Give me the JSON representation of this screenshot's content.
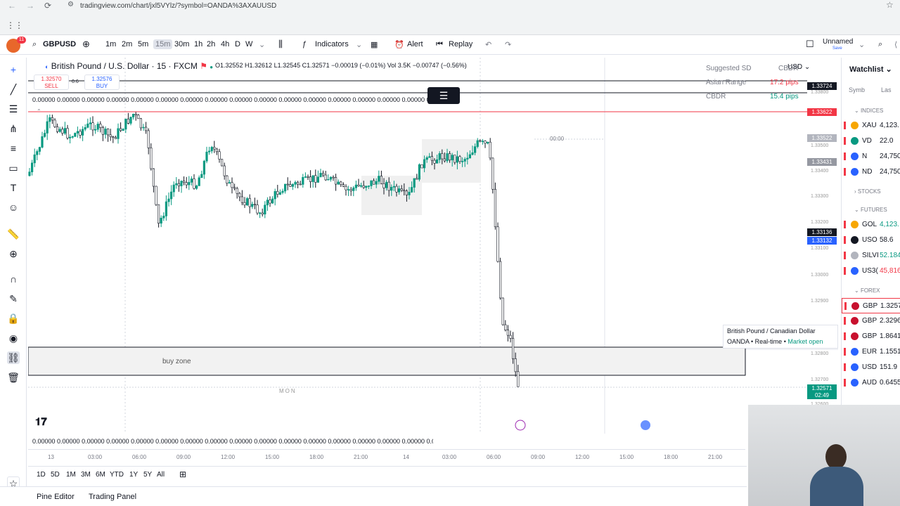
{
  "browser": {
    "url": "tradingview.com/chart/jxl5VYlz/?symbol=OANDA%3AXAUUSD"
  },
  "toolbar": {
    "symbol": "GBPUSD",
    "timeframes": [
      "1m",
      "2m",
      "5m",
      "15m",
      "30m",
      "1h",
      "2h",
      "4h",
      "D",
      "W"
    ],
    "indicators_label": "Indicators",
    "alert_label": "Alert",
    "replay_label": "Replay",
    "layout_name": "Unnamed",
    "layout_sub": "Save",
    "notification_count": "11"
  },
  "chart": {
    "title": "British Pound / U.S. Dollar · 15 · FXCM",
    "ohlc": "O1.32552 H1.32612 L1.32545 C1.32571 −0.00019 (−0.01%) Vol 3.5K −0.00747 (−0.56%)",
    "sell_price": "1.32570",
    "sell_label": "SELL",
    "buy_price": "1.32576",
    "buy_label": "BUY",
    "spread": "0.6",
    "zeros_row": "0.00000 0.00000 0.00000 0.00000 0.00000 0.00000 0.00000 0.00000 0.00000 0.00000 0.00000 0.00000 0.00000 0.00000 0.00000 0.00000 0.00000 0.00000 0.00000 0.00000 0.00000 0.00000 0.00000 0.00000 0.00000 0.00000 0.00000 0.00000 0.00000 0.00000 0.00000 0.00000 0.00000 0.00000 0.00000 0.00000 0.00000 0.00000 0.00000 0.00000 0.00000 0.00000 0.00000 0.00000 0.00000 0.00000 0.00000 0.00000 0.00000",
    "buy_zone_label": "buy zone",
    "mon_label": "MON",
    "time_marker": "00:00",
    "currency": "USD",
    "suggested_sd": "Suggested SD",
    "cbdr": "CBDR",
    "asian_range_label": "Asian Range",
    "asian_range_value": "17.2 pips",
    "cbdr_label": "CBDR",
    "cbdr_value": "15.4 pips",
    "price_tags": [
      {
        "label": "1.33724",
        "color": "#131722"
      },
      {
        "label": "1.33622",
        "color": "#f23645"
      },
      {
        "label": "1.33522",
        "color": "#b2b5be"
      },
      {
        "label": "1.33431",
        "color": "#9598a1"
      },
      {
        "label": "1.33136",
        "color": "#131722"
      },
      {
        "label": "1.33132",
        "color": "#2962ff"
      },
      {
        "label": "1.32571",
        "color": "#089981"
      },
      {
        "label": "02:49",
        "color": "#089981"
      }
    ],
    "y_ticks": [
      "1.33800",
      "1.33500",
      "1.33400",
      "1.33300",
      "1.33200",
      "1.33100",
      "1.33000",
      "1.32900",
      "1.32800",
      "1.32700",
      "1.32600"
    ],
    "x_ticks": [
      "13",
      "03:00",
      "06:00",
      "09:00",
      "12:00",
      "15:00",
      "18:00",
      "21:00",
      "14",
      "03:00",
      "06:00",
      "09:00",
      "12:00",
      "15:00",
      "18:00",
      "21:00"
    ],
    "tooltip": {
      "title": "British Pound / Canadian Dollar",
      "broker": "OANDA",
      "mode": "Real-time",
      "status": "Market open"
    }
  },
  "range_bar": [
    "1D",
    "5D",
    "1M",
    "3M",
    "6M",
    "YTD",
    "1Y",
    "5Y",
    "All"
  ],
  "bottom_panel": {
    "pine_editor": "Pine Editor",
    "trading_panel": "Trading Panel"
  },
  "watchlist": {
    "title": "Watchlist",
    "col_symbol": "Symb",
    "col_last": "Las",
    "sections": {
      "indices": "INDICES",
      "stocks": "STOCKS",
      "futures": "FUTURES",
      "forex": "FOREX"
    },
    "indices": [
      {
        "sym": "XAU",
        "val": "4,123.",
        "color": "#131722",
        "dot": "#f7a600"
      },
      {
        "sym": "VD",
        "val": "22.0",
        "color": "#131722",
        "dot": "#089981"
      },
      {
        "sym": "N",
        "val": "24,750",
        "color": "#131722",
        "dot": "#2962ff"
      },
      {
        "sym": "ND",
        "val": "24,750",
        "color": "#131722",
        "dot": "#2962ff"
      }
    ],
    "futures": [
      {
        "sym": "GOL",
        "val": "4,123.",
        "color": "#089981",
        "dot": "#f7a600"
      },
      {
        "sym": "USO",
        "val": "58.6",
        "color": "#131722",
        "dot": "#131722"
      },
      {
        "sym": "SILVI",
        "val": "52.184",
        "color": "#089981",
        "dot": "#b2b5be"
      },
      {
        "sym": "US3(",
        "val": "45,816",
        "color": "#f23645",
        "dot": "#2962ff"
      }
    ],
    "forex": [
      {
        "sym": "GBP",
        "val": "1.3257",
        "color": "#131722",
        "dot": "#c8102e"
      },
      {
        "sym": "GBP",
        "val": "2.3296",
        "color": "#131722",
        "dot": "#c8102e"
      },
      {
        "sym": "GBP",
        "val": "1.8641",
        "color": "#131722",
        "dot": "#c8102e"
      },
      {
        "sym": "EUR",
        "val": "1.1551",
        "color": "#131722",
        "dot": "#2962ff"
      },
      {
        "sym": "USD",
        "val": "151.9",
        "color": "#131722",
        "dot": "#2962ff"
      },
      {
        "sym": "AUD",
        "val": "0.6455",
        "color": "#131722",
        "dot": "#2962ff"
      }
    ]
  }
}
